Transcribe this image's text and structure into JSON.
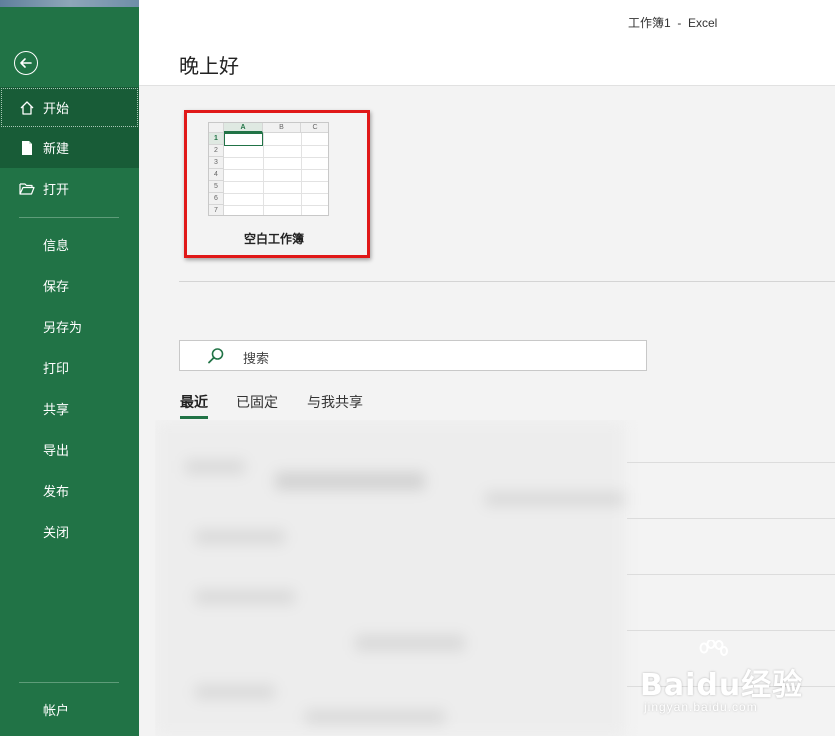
{
  "window": {
    "title": "工作簿1  -  Excel"
  },
  "header": {
    "greeting": "晚上好"
  },
  "sidebar": {
    "back_icon": "arrow-left-circle-icon",
    "primary": [
      {
        "label": "开始",
        "icon": "home-icon"
      },
      {
        "label": "新建",
        "icon": "new-file-icon"
      },
      {
        "label": "打开",
        "icon": "folder-open-icon"
      }
    ],
    "secondary": [
      "信息",
      "保存",
      "另存为",
      "打印",
      "共享",
      "导出",
      "发布",
      "关闭"
    ],
    "account": "帐户"
  },
  "templates": [
    {
      "label": "空白工作簿",
      "thumbnail": {
        "columns": [
          "A",
          "B",
          "C"
        ],
        "rows": [
          "1",
          "2",
          "3",
          "4",
          "5",
          "6",
          "7"
        ]
      }
    }
  ],
  "search": {
    "placeholder": "搜索",
    "icon": "search-icon"
  },
  "tabs": [
    "最近",
    "已固定",
    "与我共享"
  ],
  "watermark": {
    "logo": "Baidu经验",
    "sub": "jingyan.baidu.com"
  },
  "colors": {
    "brand_green": "#217346",
    "dark_green": "#185c37",
    "highlight_red": "#e01818"
  }
}
